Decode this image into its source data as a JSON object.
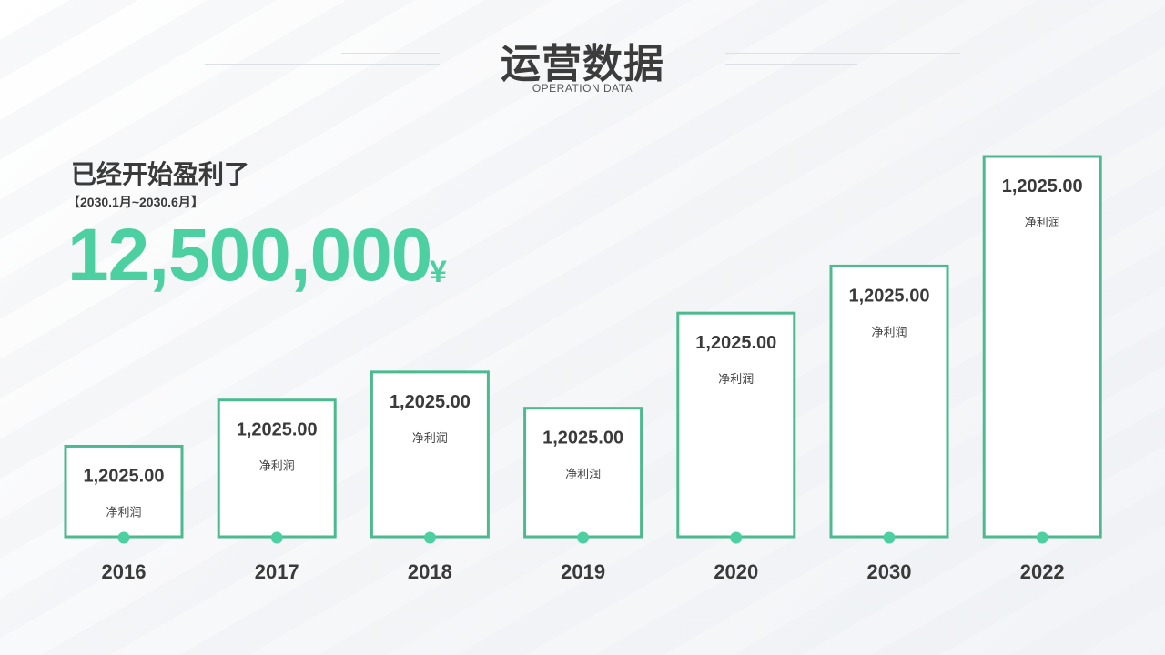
{
  "header": {
    "title": "运营数据",
    "subtitle": "OPERATION DATA"
  },
  "summary": {
    "headline": "已经开始盈利了",
    "period": "【2030.1月~2030.6月】",
    "total": "12,500,000",
    "currency": "¥"
  },
  "colors": {
    "accent": "#4ccfa1",
    "bar_border": "#4cb98f",
    "text_dark": "#3a3a3a"
  },
  "chart_data": {
    "type": "bar",
    "categories": [
      "2016",
      "2017",
      "2018",
      "2019",
      "2020",
      "2030",
      "2022"
    ],
    "values": [
      100,
      151,
      182,
      142,
      247,
      299,
      420
    ],
    "data_labels": [
      "1,2025.00",
      "1,2025.00",
      "1,2025.00",
      "1,2025.00",
      "1,2025.00",
      "1,2025.00",
      "1,2025.00"
    ],
    "sub_label": "净利润",
    "ylim": [
      0,
      420
    ],
    "grid": false,
    "legend": "none"
  }
}
